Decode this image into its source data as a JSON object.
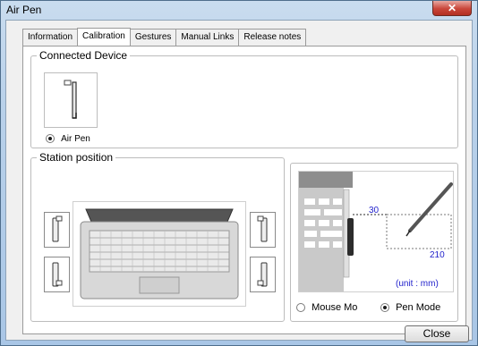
{
  "window": {
    "title": "Air Pen",
    "close_glyph": "✕"
  },
  "tabs": [
    {
      "label": "Information",
      "active": false
    },
    {
      "label": "Calibration",
      "active": true
    },
    {
      "label": "Gestures",
      "active": false
    },
    {
      "label": "Manual Links",
      "active": false
    },
    {
      "label": "Release notes",
      "active": false
    }
  ],
  "connected_device": {
    "legend": "Connected Device",
    "device_label": "Air Pen",
    "selected": true
  },
  "station_position": {
    "legend": "Station position"
  },
  "diagram": {
    "dim_top": "30",
    "dim_width": "210",
    "unit": "(unit : mm)"
  },
  "mode": {
    "mouse_label": "Mouse Mo",
    "pen_label": "Pen Mode",
    "selected": "pen"
  },
  "footer": {
    "close_label": "Close"
  },
  "colors": {
    "dimension_text": "#2222cc",
    "title_bar": "#b9d1ea"
  }
}
